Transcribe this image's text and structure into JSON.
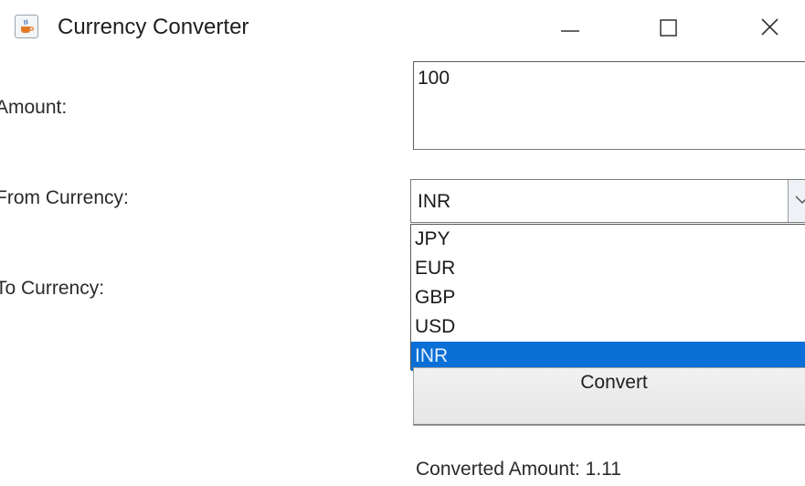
{
  "window": {
    "title": "Currency Converter",
    "icon": "java-cup-icon",
    "controls": [
      "minimize-icon",
      "maximize-icon",
      "close-icon"
    ]
  },
  "form": {
    "amount_label": "Amount:",
    "amount_value": "100",
    "from_label": "From Currency:",
    "from_selected": "INR",
    "to_label": "To Currency:",
    "dropdown_options": [
      "JPY",
      "EUR",
      "GBP",
      "USD",
      "INR"
    ],
    "dropdown_highlighted": "INR",
    "convert_label": "Convert",
    "result_text": "Converted Amount: 1.11"
  },
  "colors": {
    "selection": "#0a6fd6",
    "background": "#ffffff"
  }
}
